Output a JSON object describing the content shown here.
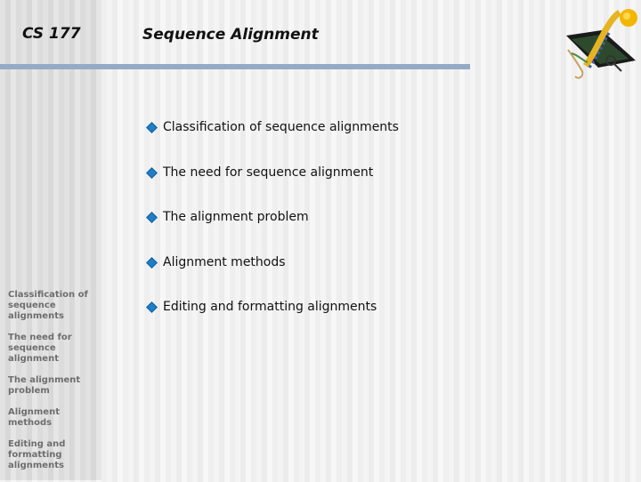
{
  "header": {
    "course": "CS 177",
    "title": "Sequence Alignment",
    "logo_icon": "dna-magnifier-logo-icon"
  },
  "colors": {
    "rule": "#94abc5",
    "bullet": "#1e7ec8"
  },
  "bullets": [
    {
      "label": "Classification of sequence alignments"
    },
    {
      "label": "The need for sequence alignment"
    },
    {
      "label": "The alignment problem"
    },
    {
      "label": "Alignment methods"
    },
    {
      "label": "Editing and formatting alignments"
    }
  ],
  "sidebar": {
    "items": [
      {
        "label": "Classification of sequence alignments"
      },
      {
        "label": "The need for sequence alignment"
      },
      {
        "label": "The alignment problem"
      },
      {
        "label": "Alignment methods"
      },
      {
        "label": "Editing and formatting alignments"
      }
    ]
  }
}
